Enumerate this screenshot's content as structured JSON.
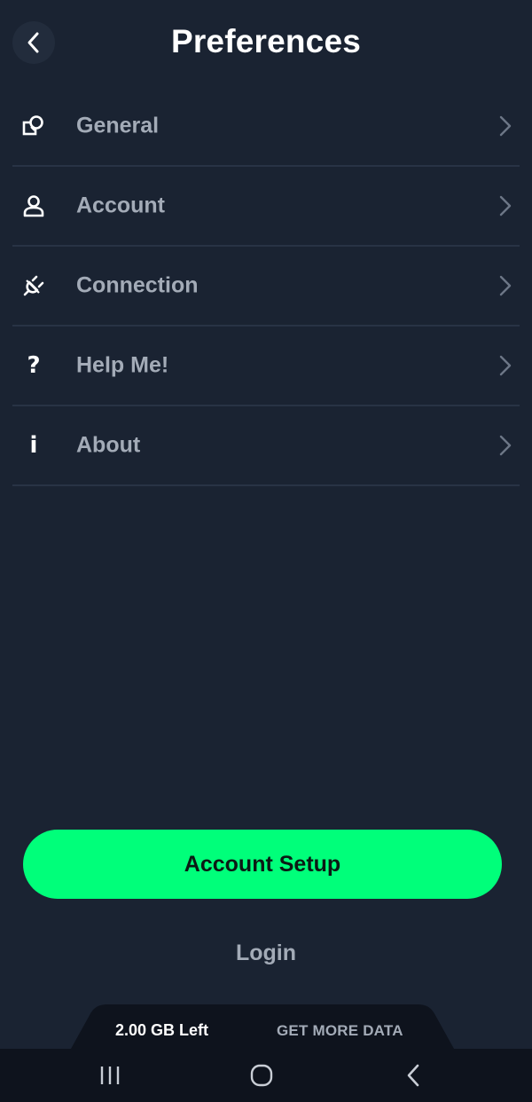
{
  "header": {
    "title": "Preferences",
    "back_icon": "chevron-left-icon"
  },
  "menu": {
    "items": [
      {
        "id": "general",
        "label": "General",
        "icon": "shapes-icon"
      },
      {
        "id": "account",
        "label": "Account",
        "icon": "user-icon"
      },
      {
        "id": "connection",
        "label": "Connection",
        "icon": "plug-icon"
      },
      {
        "id": "help",
        "label": "Help Me!",
        "icon": "question-icon",
        "glyph": "?"
      },
      {
        "id": "about",
        "label": "About",
        "icon": "info-icon",
        "glyph": "i"
      }
    ]
  },
  "actions": {
    "primary_label": "Account Setup",
    "secondary_label": "Login"
  },
  "data_tab": {
    "remaining": "2.00 GB Left",
    "cta": "GET MORE DATA"
  },
  "system_nav": {
    "icons": [
      "recent-apps-icon",
      "home-icon",
      "back-icon"
    ]
  },
  "colors": {
    "background": "#1a2332",
    "accent": "#00ff7a",
    "label": "#a3abb7",
    "divider": "#283345",
    "nav_bar": "#0e131d"
  }
}
